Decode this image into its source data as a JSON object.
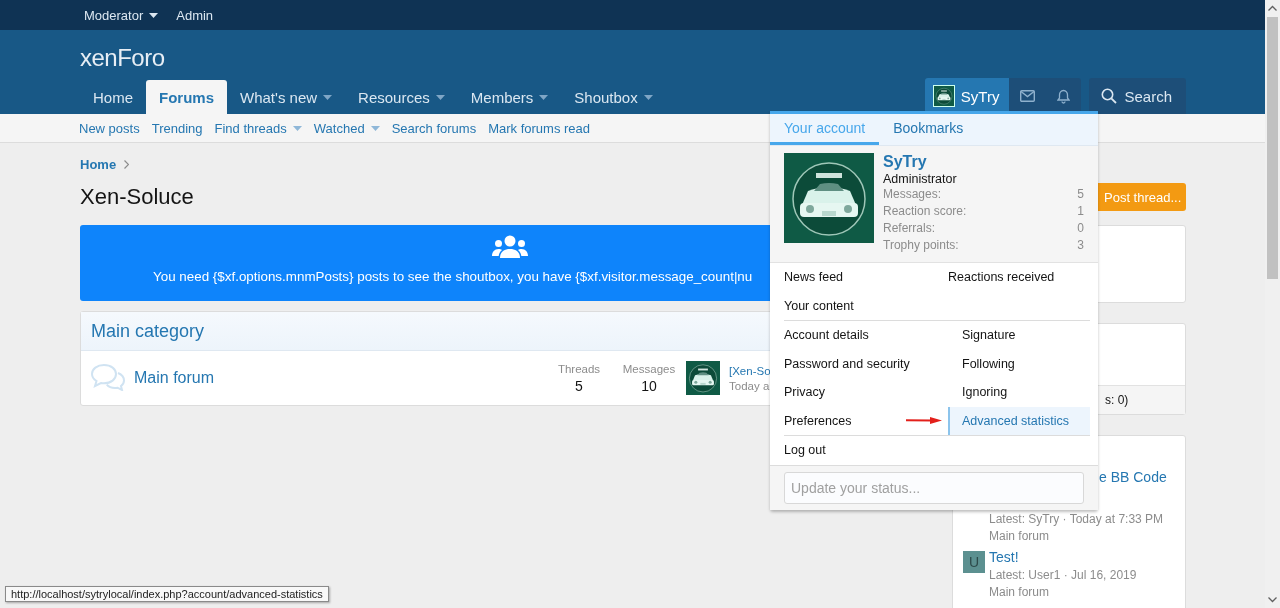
{
  "top_bar": {
    "items": [
      {
        "label": "Moderator",
        "dropdown": true
      },
      {
        "label": "Admin",
        "dropdown": false
      }
    ]
  },
  "header": {
    "logo": "xen**Foro**"
  },
  "nav": {
    "tabs": [
      {
        "label": "Home",
        "selected": false,
        "dropdown": false
      },
      {
        "label": "Forums",
        "selected": true,
        "dropdown": false
      },
      {
        "label": "What's new",
        "selected": false,
        "dropdown": true
      },
      {
        "label": "Resources",
        "selected": false,
        "dropdown": true
      },
      {
        "label": "Members",
        "selected": false,
        "dropdown": true
      },
      {
        "label": "Shoutbox",
        "selected": false,
        "dropdown": true
      }
    ],
    "user_button": {
      "label": "SyTry",
      "selected": true
    },
    "search_button": {
      "label": "Search"
    }
  },
  "sub_nav": [
    {
      "label": "New posts",
      "dropdown": false
    },
    {
      "label": "Trending",
      "dropdown": false
    },
    {
      "label": "Find threads",
      "dropdown": true
    },
    {
      "label": "Watched",
      "dropdown": true
    },
    {
      "label": "Search forums",
      "dropdown": false
    },
    {
      "label": "Mark forums read",
      "dropdown": false
    }
  ],
  "breadcrumb": [
    "Home"
  ],
  "page_title": "Xen-Soluce",
  "post_thread_button": "Post thread...",
  "notice": {
    "text": "You need {$xf.options.mnmPosts} posts to see the shoutbox, you have {$xf.visitor.message_count|nu"
  },
  "node_list": {
    "category": "Main category",
    "forums": [
      {
        "title": "Main forum",
        "stats": [
          {
            "label": "Threads",
            "value": "5"
          },
          {
            "label": "Messages",
            "value": "10"
          }
        ],
        "last_post_title": "[Xen-So",
        "last_post_meta": "Today a"
      }
    ]
  },
  "sidebar": {
    "cards": [
      {
        "kind": "blank"
      },
      {
        "kind": "footer",
        "footer": "s: 0)"
      },
      {
        "kind": "threads",
        "threads": [
          {
            "title": "e BB Code",
            "meta": "Latest: SyTry · Today at 7:33 PM",
            "forum": "Main forum"
          },
          {
            "avatar": "U",
            "title": "Test!",
            "meta": "Latest: User1 · Jul 16, 2019",
            "forum": "Main forum"
          }
        ]
      }
    ]
  },
  "account_popup": {
    "tabs": [
      {
        "label": "Your account",
        "selected": true
      },
      {
        "label": "Bookmarks",
        "selected": false
      }
    ],
    "profile": {
      "name": "SyTry",
      "role": "Administrator",
      "stats": [
        {
          "label": "Messages:",
          "value": "5"
        },
        {
          "label": "Reaction score:",
          "value": "1"
        },
        {
          "label": "Referrals:",
          "value": "0"
        },
        {
          "label": "Trophy points:",
          "value": "3"
        }
      ]
    },
    "link_groups": [
      {
        "items": [
          {
            "label": "News feed",
            "hovered": false
          },
          {
            "label": "Reactions received",
            "hovered": false
          },
          {
            "label": "Your content",
            "hovered": false
          }
        ]
      },
      {
        "items": [
          {
            "label": "Account details",
            "hovered": false
          },
          {
            "label": "Signature",
            "hovered": false
          },
          {
            "label": "Password and security",
            "hovered": false
          },
          {
            "label": "Following",
            "hovered": false
          },
          {
            "label": "Privacy",
            "hovered": false
          },
          {
            "label": "Ignoring",
            "hovered": false
          },
          {
            "label": "Preferences",
            "hovered": false
          },
          {
            "label": "Advanced statistics",
            "hovered": true
          }
        ]
      },
      {
        "items": [
          {
            "label": "Log out",
            "hovered": false
          }
        ]
      }
    ],
    "status_field": {
      "placeholder": "Update your status..."
    }
  },
  "status_tooltip": "http://localhost/sytrylocal/index.php?account/advanced-statistics"
}
